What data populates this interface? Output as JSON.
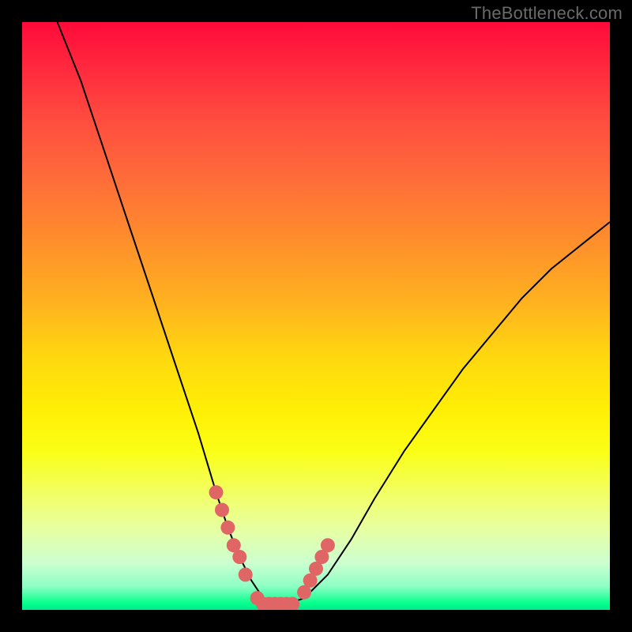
{
  "watermark": "TheBottleneck.com",
  "colors": {
    "background": "#000000",
    "curve_stroke": "#000000",
    "marker_fill": "#e06666",
    "gradient_top": "#ff0a3a",
    "gradient_bottom": "#00ff8a"
  },
  "chart_data": {
    "type": "line",
    "title": "",
    "xlabel": "",
    "ylabel": "",
    "xlim": [
      0,
      100
    ],
    "ylim": [
      0,
      100
    ],
    "grid": false,
    "legend": false,
    "annotations": [],
    "series": [
      {
        "name": "bottleneck-curve",
        "description": "V-shaped curve. Left branch descends steeply from top-left toward the trough; trough is flat near the bottom; right branch rises more gently toward the upper-right. Values are approximate (read off the plot; no axis ticks are shown).",
        "x": [
          6,
          10,
          14,
          18,
          22,
          26,
          30,
          33,
          35,
          37,
          39,
          41,
          43,
          45,
          48,
          52,
          56,
          60,
          65,
          70,
          75,
          80,
          85,
          90,
          95,
          100
        ],
        "y": [
          100,
          90,
          78,
          66,
          54,
          42,
          30,
          20,
          14,
          9,
          5,
          2,
          1,
          1,
          2,
          6,
          12,
          19,
          27,
          34,
          41,
          47,
          53,
          58,
          62,
          66
        ]
      }
    ],
    "markers": {
      "name": "highlight-points",
      "description": "Thick salmon segments near the trough on both branches plus a flat trough segment.",
      "points": [
        {
          "x": 33,
          "y": 20
        },
        {
          "x": 34,
          "y": 17
        },
        {
          "x": 35,
          "y": 14
        },
        {
          "x": 36,
          "y": 11
        },
        {
          "x": 37,
          "y": 9
        },
        {
          "x": 38,
          "y": 6
        },
        {
          "x": 40,
          "y": 2
        },
        {
          "x": 41,
          "y": 1
        },
        {
          "x": 42,
          "y": 1
        },
        {
          "x": 43,
          "y": 1
        },
        {
          "x": 44,
          "y": 1
        },
        {
          "x": 45,
          "y": 1
        },
        {
          "x": 46,
          "y": 1
        },
        {
          "x": 48,
          "y": 3
        },
        {
          "x": 49,
          "y": 5
        },
        {
          "x": 50,
          "y": 7
        },
        {
          "x": 51,
          "y": 9
        },
        {
          "x": 52,
          "y": 11
        }
      ]
    }
  }
}
